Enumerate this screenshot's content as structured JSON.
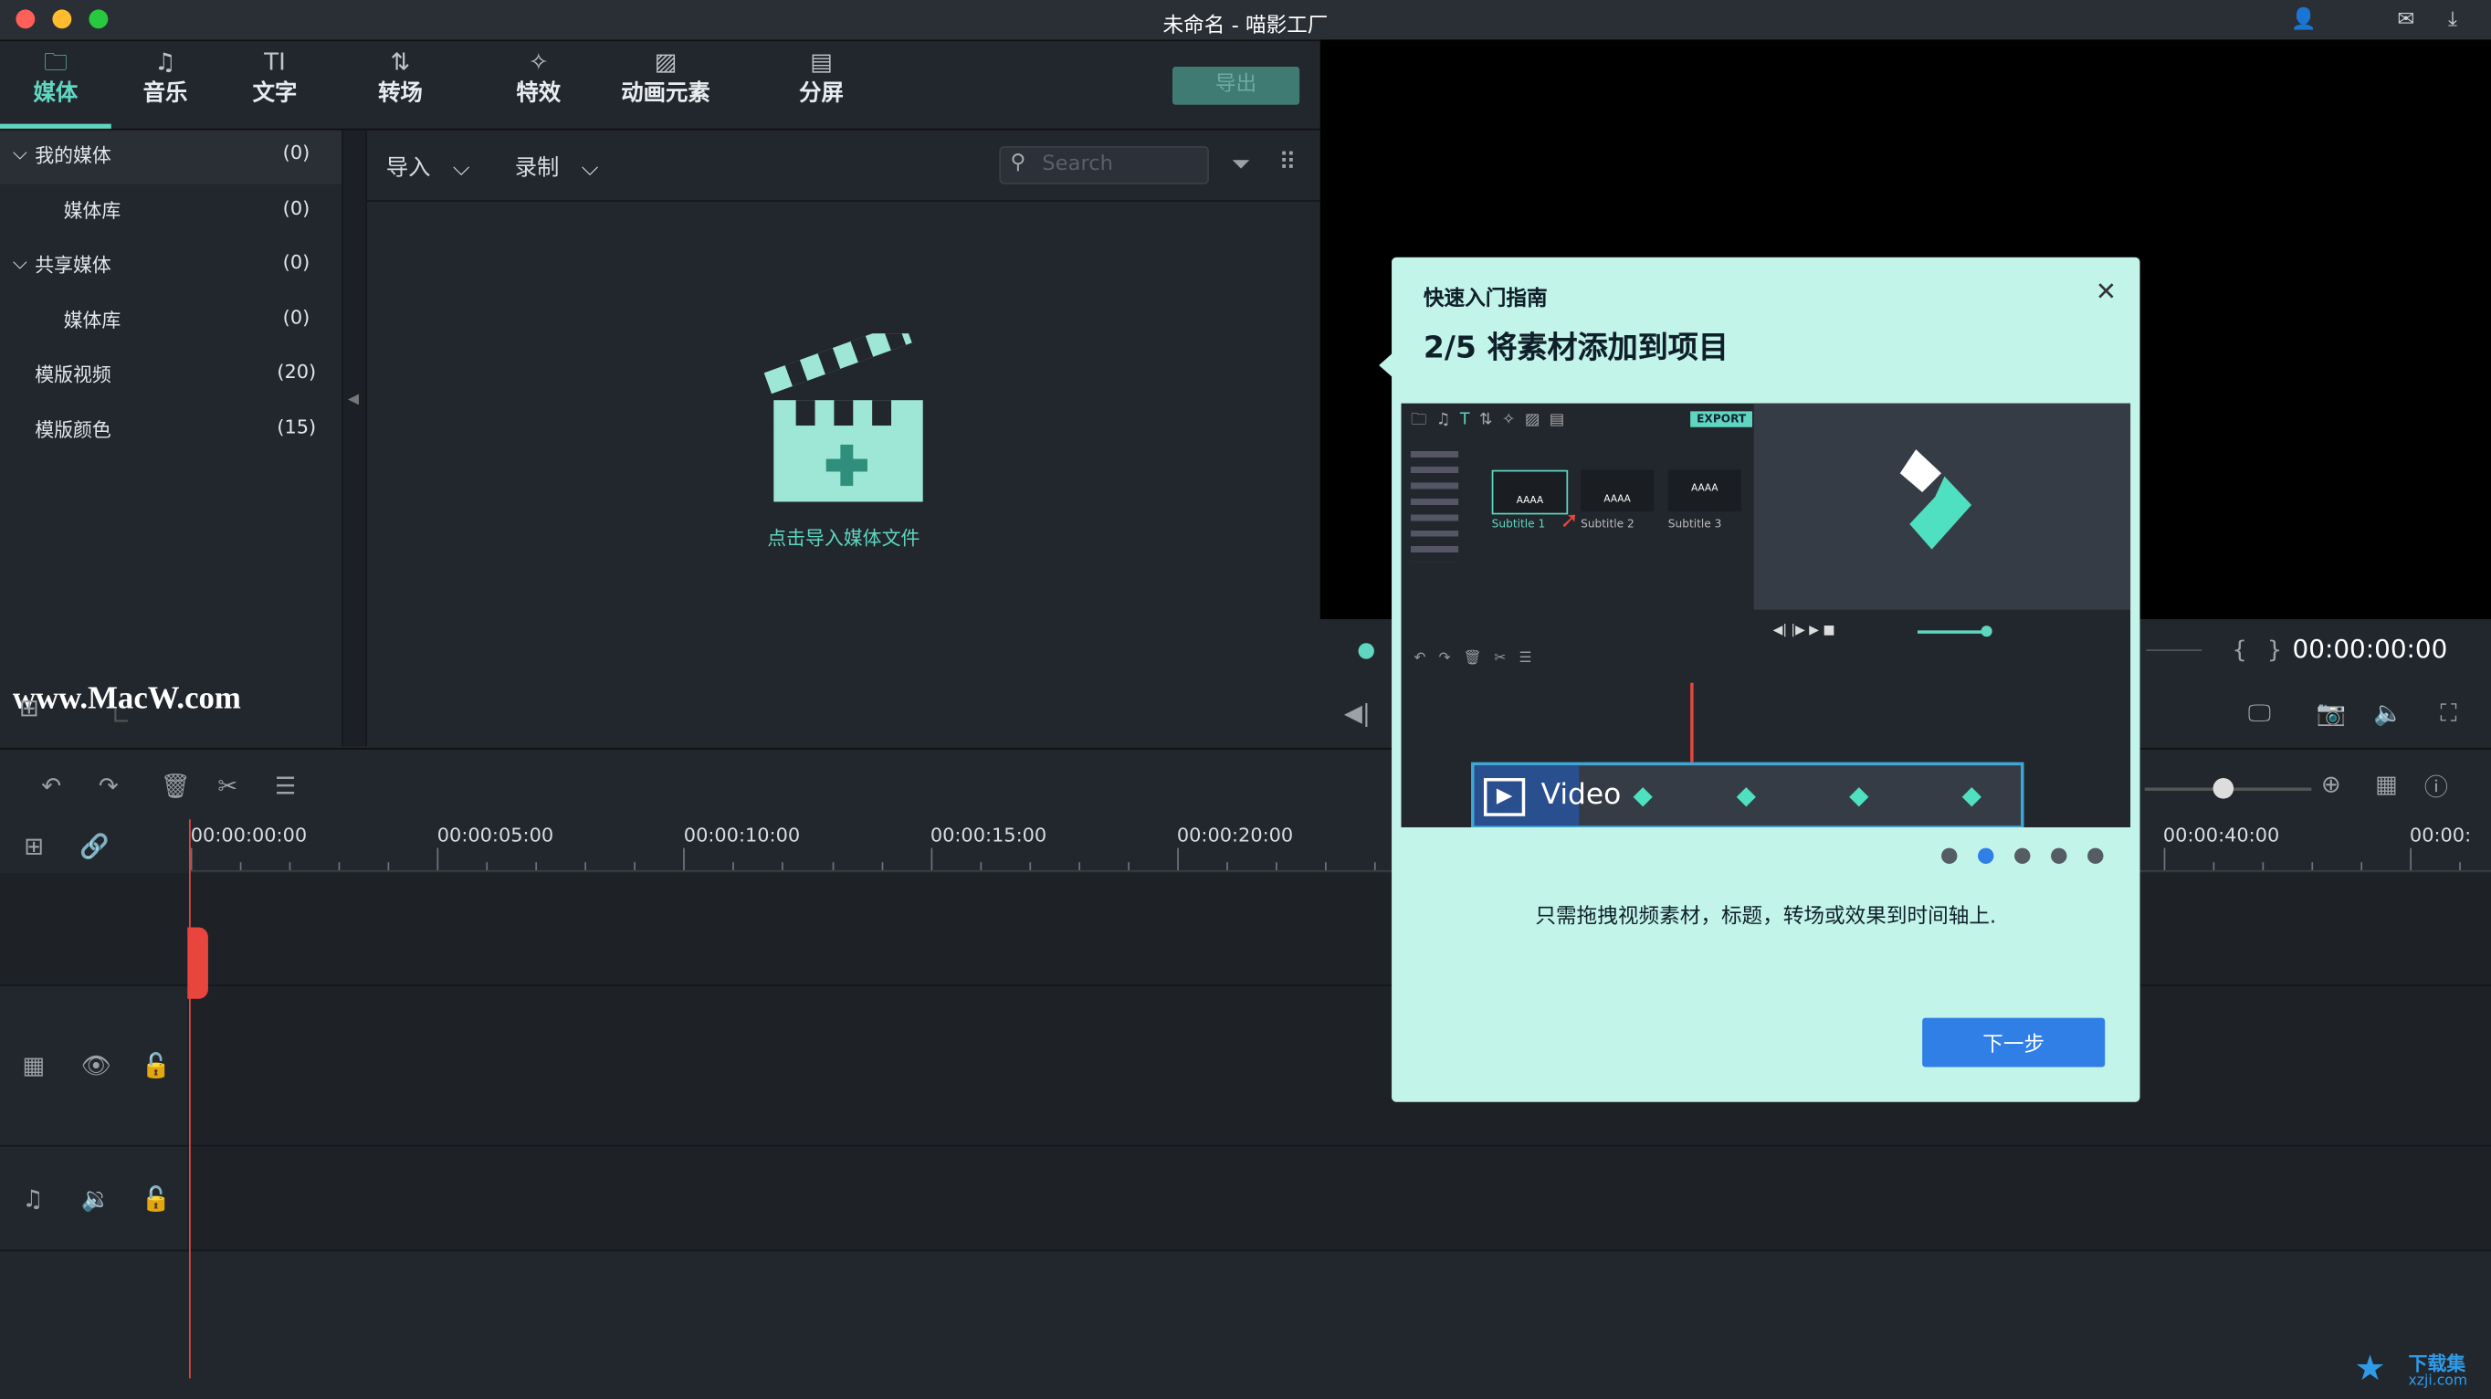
{
  "window": {
    "title": "未命名 - 喵影工厂",
    "lights": [
      "#fe5f57",
      "#febc2e",
      "#28c840"
    ],
    "icons": [
      "user-icon",
      "mail-icon",
      "download-icon"
    ]
  },
  "tabs": [
    {
      "label": "媒体",
      "icon": "folder-icon",
      "glyph": "🗀",
      "active": true
    },
    {
      "label": "音乐",
      "icon": "music-icon",
      "glyph": "♫"
    },
    {
      "label": "文字",
      "icon": "text-icon",
      "glyph": "TI"
    },
    {
      "label": "转场",
      "icon": "transition-icon",
      "glyph": "⇅"
    },
    {
      "label": "特效",
      "icon": "effects-icon",
      "glyph": "✧"
    },
    {
      "label": "动画元素",
      "icon": "image-icon",
      "glyph": "▨"
    },
    {
      "label": "分屏",
      "icon": "split-screen-icon",
      "glyph": "▤"
    }
  ],
  "export_label": "导出",
  "sidebar": [
    {
      "label": "我的媒体",
      "count": "(0)",
      "expandable": true,
      "selected": true
    },
    {
      "label": "媒体库",
      "count": "(0)",
      "indent": true
    },
    {
      "label": "共享媒体",
      "count": "(0)",
      "expandable": true
    },
    {
      "label": "媒体库",
      "count": "(0)",
      "indent": true
    },
    {
      "label": "模版视频",
      "count": "(20)"
    },
    {
      "label": "模版颜色",
      "count": "(15)"
    }
  ],
  "media": {
    "import_label": "导入",
    "record_label": "录制",
    "search_placeholder": "Search",
    "empty_text": "点击导入媒体文件"
  },
  "watermark": "www.MacW.com",
  "preview": {
    "timecode": "00:00:00:00"
  },
  "timeline": {
    "labels": [
      [
        "00:00:00:00",
        0
      ],
      [
        "00:00:05:00",
        5
      ],
      [
        "00:00:10:00",
        10
      ],
      [
        "00:00:15:00",
        15
      ],
      [
        "00:00:20:00",
        20
      ],
      [
        "00:00:40:00",
        40
      ],
      [
        "00:00:",
        45
      ]
    ]
  },
  "dialog": {
    "header": "快速入门指南",
    "title": "2/5 将素材添加到项目",
    "step": 2,
    "total_steps": 5,
    "description": "只需拖拽视频素材，标题，转场或效果到时间轴上.",
    "next_label": "下一步",
    "illustration": {
      "export": "EXPORT",
      "thumb_text": "AAAA",
      "subtitles": [
        "Subtitle 1",
        "Subtitle 2",
        "Subtitle 3"
      ],
      "clip": "Video"
    },
    "active_dot_color": "#2f7fe6"
  },
  "site_logo": {
    "name": "下载集",
    "url_text": "xzji.com"
  }
}
